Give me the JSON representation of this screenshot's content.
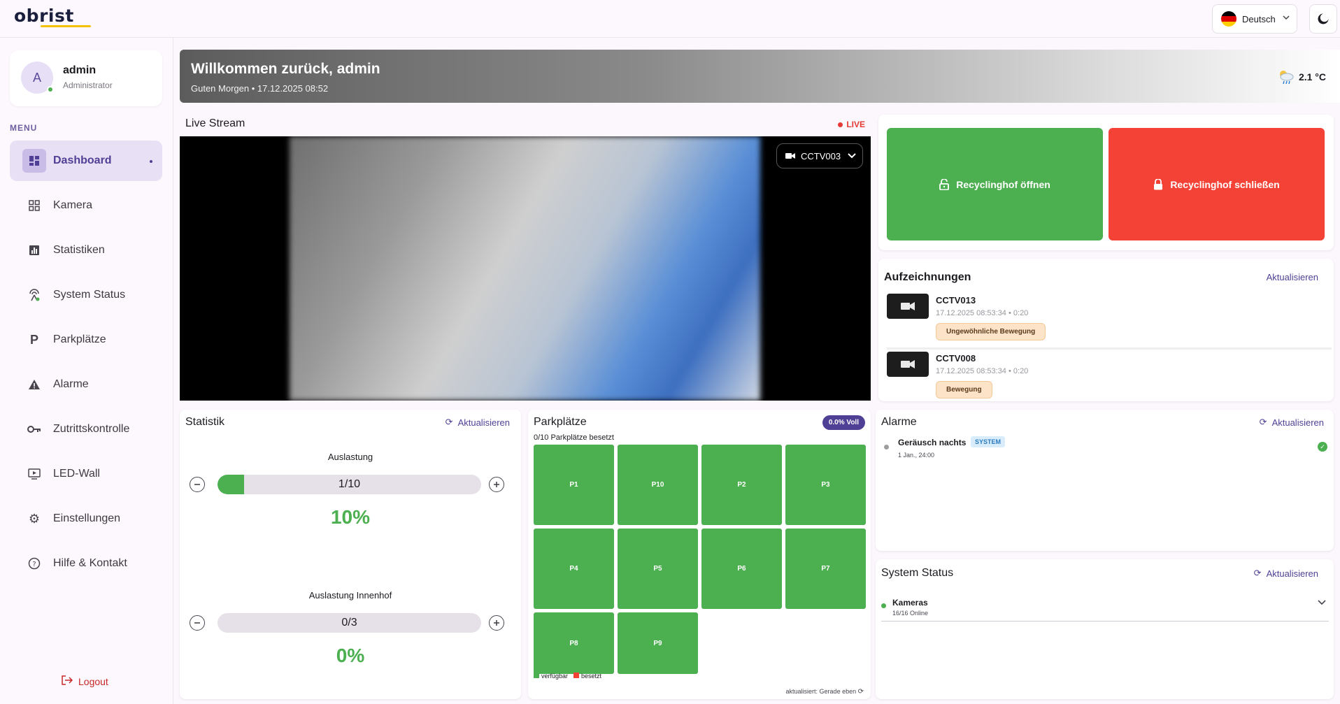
{
  "header": {
    "logo": "obrist",
    "language": "Deutsch",
    "theme_toggle_icon": "moon-icon",
    "colors": {
      "logo_underline": "#f2c200",
      "flag": [
        "#000000",
        "#dd0000",
        "#ffce00"
      ]
    }
  },
  "user": {
    "avatar_initial": "A",
    "name": "admin",
    "role": "Administrator"
  },
  "sidebar": {
    "menu_title": "MENU",
    "items": [
      {
        "label": "Dashboard",
        "icon": "dashboard-icon",
        "active": true
      },
      {
        "label": "Kamera",
        "icon": "grid-icon"
      },
      {
        "label": "Statistiken",
        "icon": "bar-chart-icon"
      },
      {
        "label": "System Status",
        "icon": "antenna-icon"
      },
      {
        "label": "Parkplätze",
        "icon": "parking-icon"
      },
      {
        "label": "Alarme",
        "icon": "warning-icon"
      },
      {
        "label": "Zutrittskontrolle",
        "icon": "key-icon"
      },
      {
        "label": "LED-Wall",
        "icon": "display-icon"
      },
      {
        "label": "Einstellungen",
        "icon": "gear-icon"
      },
      {
        "label": "Hilfe & Kontakt",
        "icon": "help-icon"
      }
    ],
    "logout": "Logout"
  },
  "banner": {
    "title": "Willkommen zurück, admin",
    "subtitle": "Guten Morgen • 17.12.2025 08:52",
    "temperature": "2.1 °C",
    "weather_icon": "cloud-rain-icon"
  },
  "live_stream": {
    "title": "Live Stream",
    "badge": "LIVE",
    "camera": "CCTV003"
  },
  "actions": {
    "open": "Recyclinghof öffnen",
    "close": "Recyclinghof schließen",
    "colors": {
      "open": "#4caf50",
      "close": "#f44336"
    }
  },
  "recordings": {
    "title": "Aufzeichnungen",
    "refresh": "Aktualisieren",
    "items": [
      {
        "camera": "CCTV013",
        "meta": "17.12.2025 08:53:34 • 0:20",
        "tag": "Ungewöhnliche Bewegung"
      },
      {
        "camera": "CCTV008",
        "meta": "17.12.2025 08:53:34 • 0:20",
        "tag": "Bewegung"
      }
    ]
  },
  "statistik": {
    "title": "Statistik",
    "refresh": "Aktualisieren",
    "auslastung": {
      "label": "Auslastung",
      "value": "1/10",
      "percent": "10%",
      "fill": 0.1
    },
    "innenhof": {
      "label": "Auslastung Innenhof",
      "value": "0/3",
      "percent": "0%",
      "fill": 0
    }
  },
  "parking": {
    "title": "Parkplätze",
    "badge": "0.0% Voll",
    "subtitle": "0/10 Parkplätze besetzt",
    "spots": [
      "P1",
      "P10",
      "P2",
      "P3",
      "P4",
      "P5",
      "P6",
      "P7",
      "P8",
      "P9"
    ],
    "legend": {
      "available": "verfügbar",
      "occupied": "besetzt"
    },
    "updated": "aktualisiert: Gerade eben",
    "colors": {
      "available": "#4caf50",
      "occupied": "#f44336"
    }
  },
  "alarms": {
    "title": "Alarme",
    "refresh": "Aktualisieren",
    "items": [
      {
        "name": "Geräusch nachts",
        "badge": "SYSTEM",
        "time": "1 Jan., 24:00"
      }
    ]
  },
  "system_status": {
    "title": "System Status",
    "refresh": "Aktualisieren",
    "items": [
      {
        "name": "Kameras",
        "detail": "16/16 Online"
      }
    ]
  }
}
